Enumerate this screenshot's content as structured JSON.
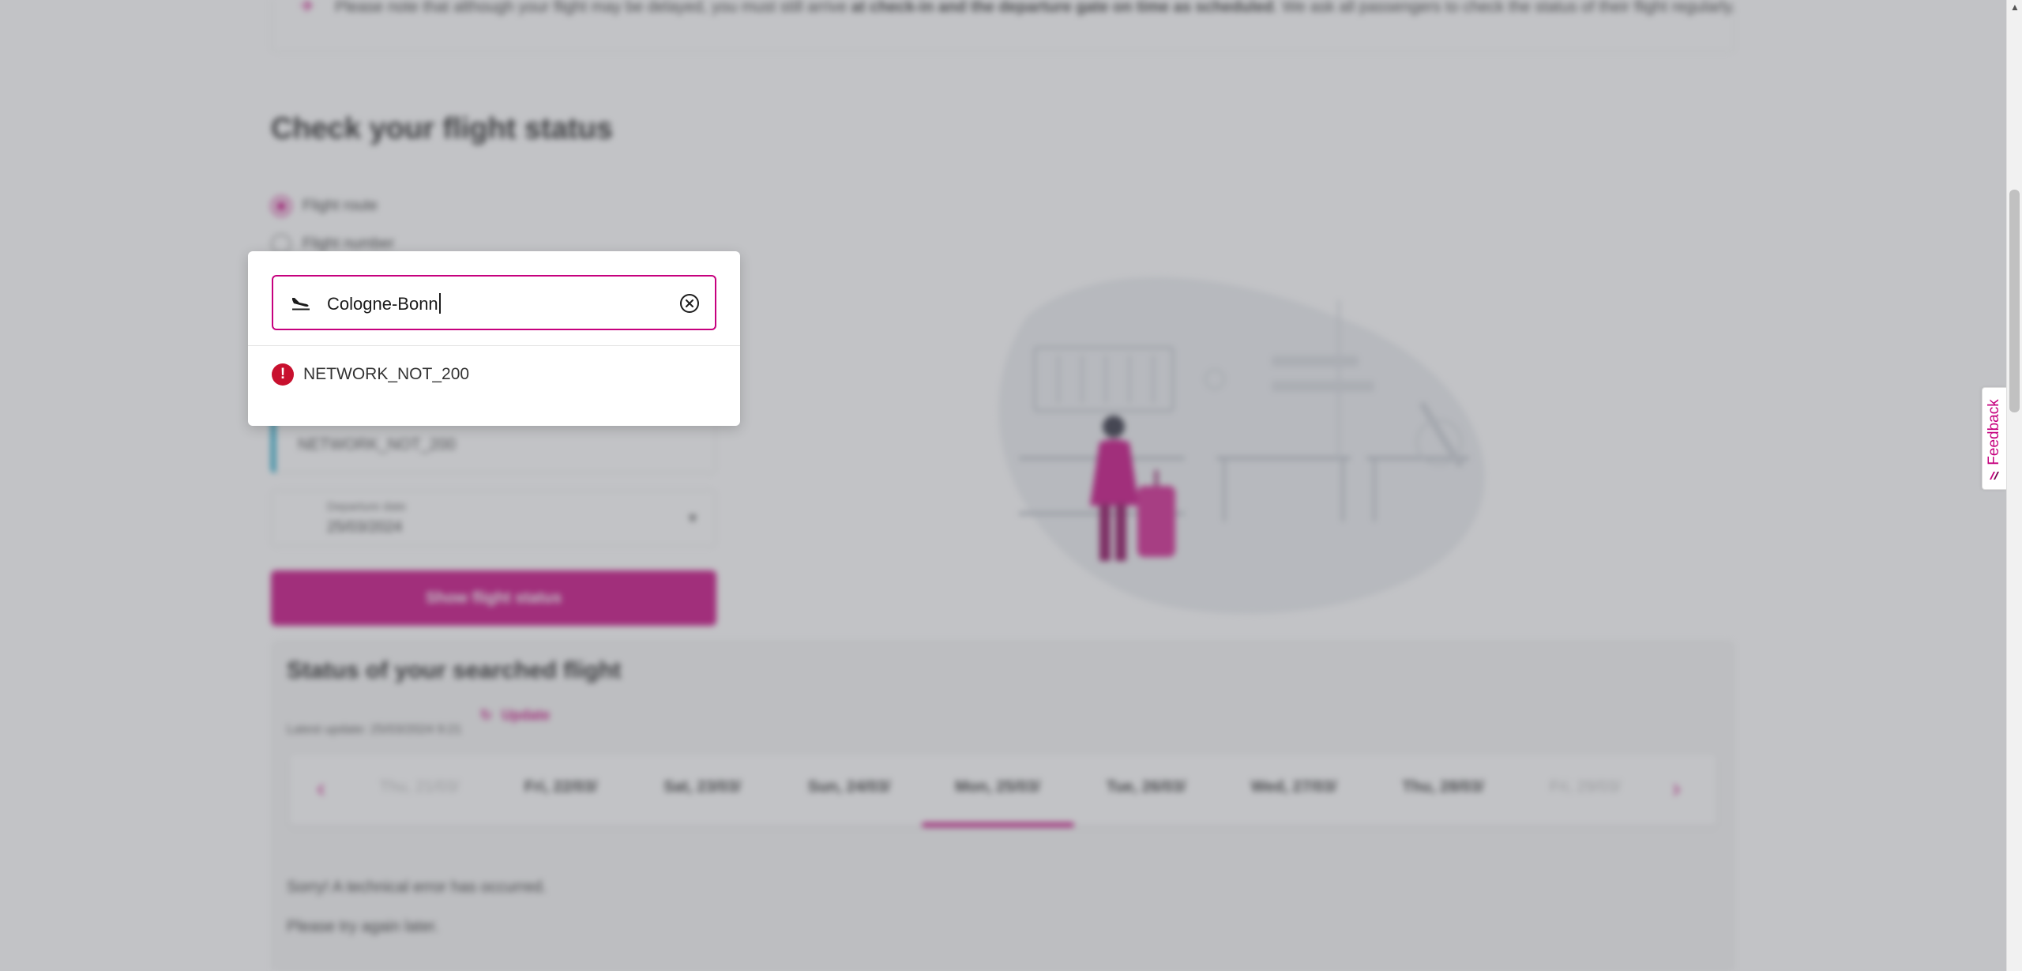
{
  "background": {
    "notice": {
      "text_start": "Please note that although your flight may be delayed, you must still arrive ",
      "text_bold": "at check-in and the departure gate on time as scheduled",
      "text_end": ". We ask all passengers to check the status of their flight regularly."
    },
    "heading": "Check your flight status",
    "search_mode": {
      "options": [
        {
          "label": "Flight route",
          "selected": true
        },
        {
          "label": "Flight number",
          "selected": false
        }
      ]
    },
    "route_error_value": "NETWORK_NOT_200",
    "departure_date": {
      "label": "Departure date",
      "value": "25/03/2024"
    },
    "submit_label": "Show flight status",
    "status_section": {
      "title": "Status of your searched flight",
      "last_update": "Latest update: 25/03/2024 9:21",
      "refresh_label": "Update",
      "days": [
        {
          "label": "Thu, 21/03/",
          "muted": true
        },
        {
          "label": "Fri, 22/03/",
          "muted": false
        },
        {
          "label": "Sat, 23/03/",
          "muted": false
        },
        {
          "label": "Sun, 24/03/",
          "muted": false
        },
        {
          "label": "Mon, 25/03/",
          "muted": false,
          "selected": true
        },
        {
          "label": "Tue, 26/03/",
          "muted": false
        },
        {
          "label": "Wed, 27/03/",
          "muted": false
        },
        {
          "label": "Thu, 28/03/",
          "muted": false
        },
        {
          "label": "Fri, 29/03/",
          "muted": true
        }
      ],
      "error_line_1": "Sorry! A technical error has occurred.",
      "error_line_2": "Please try again later."
    }
  },
  "modal": {
    "search_value": "Cologne-Bonn",
    "error_message": "NETWORK_NOT_200",
    "icons": {
      "leading": "plane-arrival-icon",
      "clear": "clear-circle-x-icon",
      "error": "error-exclamation-icon"
    }
  },
  "feedback_tab": {
    "label": "Feedback"
  },
  "colors": {
    "brand": "#c6007e",
    "error": "#c8102e",
    "accent_blue": "#06a0c6"
  }
}
